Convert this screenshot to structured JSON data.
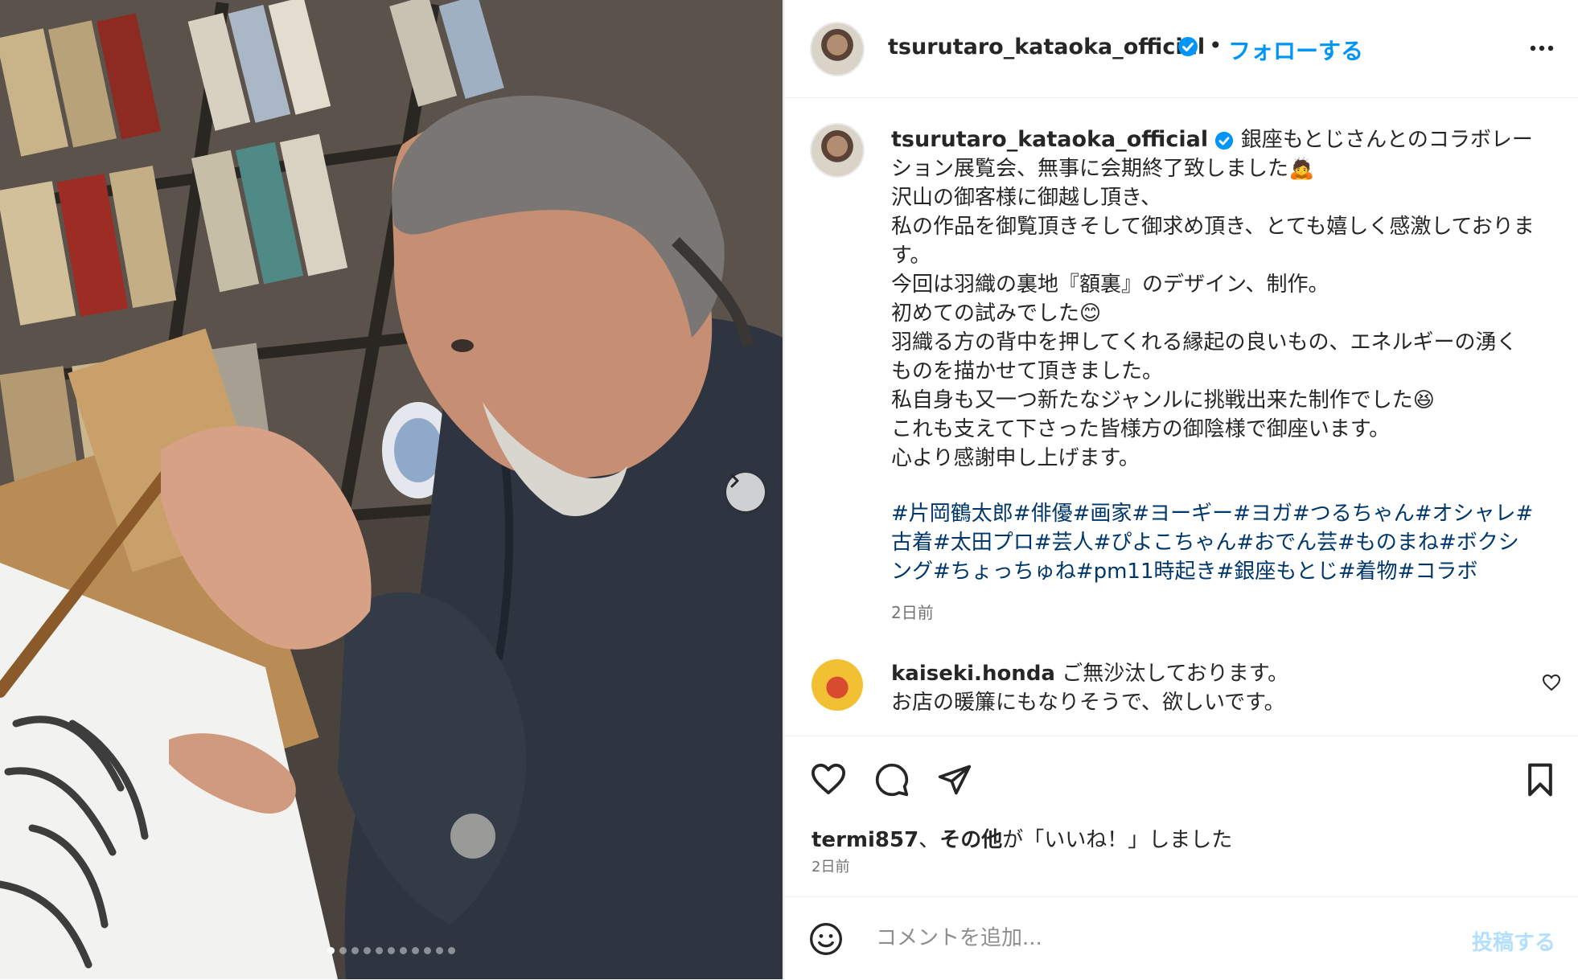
{
  "post": {
    "username": "tsurutaro_kataoka_official",
    "follow_label": "フォローする",
    "bullet": "•",
    "caption_lines": "銀座もとじさんとのコラボレーション展覧会、無事に会期終了致しました🙇\n沢山の御客様に御越し頂き、\n私の作品を御覧頂きそして御求め頂き、とても嬉しく感激しております。\n今回は羽織の裏地『額裏』のデザイン、制作。\n初めての試みでした😊\n羽織る方の背中を押してくれる縁起の良いもの、エネルギーの湧くものを描かせて頂きました。\n私自身も又一つ新たなジャンルに挑戦出来た制作でした😆\nこれも支えて下さった皆様方の御陰様で御座います。\n心より感謝申し上げます。",
    "hashtags": "#片岡鶴太郎#俳優#画家#ヨーギー#ヨガ#つるちゃん#オシャレ#古着#太田プロ#芸人#ぴよこちゃん#おでん芸#ものまね#ボクシング#ちょっちゅね#pm11時起き#銀座もとじ#着物#コラボ",
    "caption_time": "2日前"
  },
  "comment": {
    "username": "kaiseki.honda",
    "text": "ご無沙汰しております。\nお店の暖簾にもなりそうで、欲しいです。"
  },
  "likes": {
    "user": "termi857",
    "sep": "、",
    "others": "その他",
    "suffix": "が「いいね！」しました",
    "time": "2日前"
  },
  "add_comment": {
    "placeholder": "コメントを追加...",
    "post_label": "投稿する"
  },
  "carousel": {
    "slide_count": 11,
    "active_index": 0
  },
  "colors": {
    "accent": "#0095f6",
    "hashtag": "#00376b",
    "muted": "#737373"
  },
  "icons": [
    "chevron-right-icon",
    "verified-icon",
    "more-icon",
    "heart-icon",
    "comment-icon",
    "share-icon",
    "bookmark-icon",
    "emoji-icon"
  ]
}
